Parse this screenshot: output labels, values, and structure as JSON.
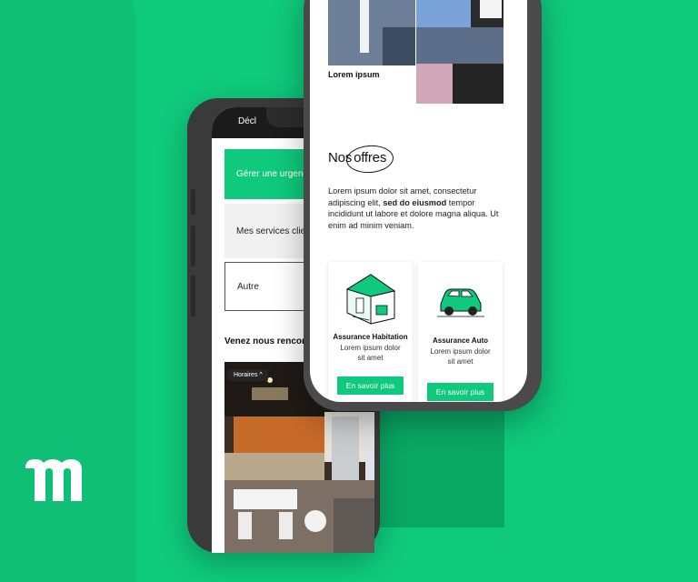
{
  "phone_left": {
    "topbar_text": "Décl",
    "buttons": [
      {
        "label": "Gérer une urgence"
      },
      {
        "label": "Mes services clients"
      },
      {
        "label": "Autre"
      }
    ],
    "section_title": "Venez nous rencontrer",
    "photo_pill": "Horaires ^"
  },
  "phone_right": {
    "image_caption": "Lorem ipsum",
    "heading_prefix": "Nos",
    "heading_circled": "offres",
    "intro_part1": "Lorem ipsum dolor sit amet, consectetur adipiscing elit, ",
    "intro_bold": "sed do eiusmod",
    "intro_part2": " tempor incididunt ut labore et dolore magna aliqua. Ut enim ad minim veniam.",
    "cards": [
      {
        "icon": "house-icon",
        "title": "Assurance Habitation",
        "description": "Lorem ipsum dolor sit amet",
        "cta": "En savoir plus"
      },
      {
        "icon": "car-icon",
        "title": "Assurance Auto",
        "description": "Lorem ipsum dolor sit amet",
        "cta": "En savoir plus"
      }
    ]
  },
  "colors": {
    "brand_green": "#0fc97c",
    "phone_frame": "#3a3a3a"
  }
}
